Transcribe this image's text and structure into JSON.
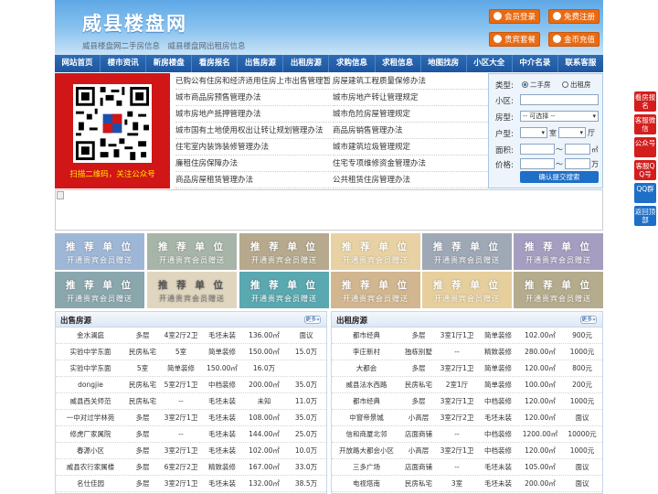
{
  "header": {
    "title": "威县楼盘网",
    "subtitle": "威县楼盘网二手房信息　威县楼盘网出租房信息",
    "buttons": [
      "会员登录",
      "免费注册",
      "贵宾套餐",
      "金币充值"
    ]
  },
  "nav": [
    "网站首页",
    "楼市资讯",
    "新房楼盘",
    "看房报名",
    "出售房源",
    "出租房源",
    "求购信息",
    "求租信息",
    "地图找房",
    "小区大全",
    "中介名录",
    "联系客服"
  ],
  "qr": {
    "caption": "扫描二维码，关注公众号"
  },
  "news": {
    "left": [
      "已购公有住房和经济适用住房上市出售管理暂",
      "城市商品房预售管理办法",
      "城市房地产抵押管理办法",
      "城市国有土地使用权出让转让规划管理办法",
      "住宅室内装饰装修管理办法",
      "廉租住房保障办法",
      "商品房屋租赁管理办法"
    ],
    "right": [
      "房屋建筑工程质量保修办法",
      "城市房地产转让管理规定",
      "城市危险房屋管理规定",
      "商品房销售管理办法",
      "城市建筑垃圾管理规定",
      "住宅专项维修资金管理办法",
      "公共租赁住房管理办法"
    ]
  },
  "search": {
    "type_label": "类型:",
    "type_options": [
      "二手房",
      "出租房"
    ],
    "community_label": "小区:",
    "house_type_label": "房型:",
    "house_type_value": "-- 可选择 --",
    "layout_label": "户型:",
    "room_unit": "室",
    "hall_unit": "厅",
    "area_label": "面积:",
    "area_sep": "～",
    "area_unit": "㎡",
    "price_label": "价格:",
    "price_sep": "～",
    "price_unit": "万",
    "submit": "确认提交搜索"
  },
  "ads": {
    "title": "推 荐 单 位",
    "subtitle": "开通贵宾会员赠送"
  },
  "sale": {
    "title": "出售房源",
    "more": "更多»",
    "rows": [
      [
        "金水澜庭",
        "多层",
        "4室2厅2卫",
        "毛坯未装",
        "136.00㎡",
        "面议"
      ],
      [
        "实验中学东面",
        "民房私宅",
        "5室",
        "简单装修",
        "150.00㎡",
        "15.0万"
      ],
      [
        "实验中学东面",
        "5室",
        "简单装修",
        "150.00㎡",
        "16.0万"
      ],
      [
        "dongjie",
        "民房私宅",
        "5室2厅1卫",
        "中档装修",
        "200.00㎡",
        "35.0万"
      ],
      [
        "威县西关师范",
        "民房私宅",
        "--",
        "毛坯未装",
        "未知",
        "11.0万"
      ],
      [
        "一中对过学林苑",
        "多层",
        "3室2厅1卫",
        "毛坯未装",
        "108.00㎡",
        "35.0万"
      ],
      [
        "修虎厂家属院",
        "多层",
        "--",
        "毛坯未装",
        "144.00㎡",
        "25.0万"
      ],
      [
        "春源小区",
        "多层",
        "3室2厅1卫",
        "毛坯未装",
        "102.00㎡",
        "10.0万"
      ],
      [
        "威县农行家属楼",
        "多层",
        "6室2厅2卫",
        "精致装修",
        "167.00㎡",
        "33.0万"
      ],
      [
        "名仕佳园",
        "多层",
        "3室2厅1卫",
        "毛坯未装",
        "132.00㎡",
        "38.5万"
      ]
    ]
  },
  "rent": {
    "title": "出租房源",
    "more": "更多»",
    "rows": [
      [
        "都市经典",
        "多层",
        "3室1厅1卫",
        "简单装修",
        "102.00㎡",
        "900元"
      ],
      [
        "李庄新村",
        "独栋别墅",
        "--",
        "精致装修",
        "280.00㎡",
        "1000元"
      ],
      [
        "大都会",
        "多层",
        "3室2厅1卫",
        "简单装修",
        "120.00㎡",
        "800元"
      ],
      [
        "威县法水西路",
        "民房私宅",
        "2室1厅",
        "简单装修",
        "100.00㎡",
        "200元"
      ],
      [
        "都市经典",
        "多层",
        "3室2厅1卫",
        "中档装修",
        "120.00㎡",
        "1000元"
      ],
      [
        "中窗帝景城",
        "小高层",
        "3室2厅2卫",
        "毛坯未装",
        "120.00㎡",
        "面议"
      ],
      [
        "信和商厦北邻",
        "店面商铺",
        "--",
        "中档装修",
        "1200.00㎡",
        "10000元"
      ],
      [
        "开放路大都会小区",
        "小高层",
        "3室2厅1卫",
        "中档装修",
        "120.00㎡",
        "1000元"
      ],
      [
        "三多广场",
        "店面商铺",
        "--",
        "毛坯未装",
        "105.00㎡",
        "面议"
      ],
      [
        "电视塔南",
        "民房私宅",
        "3室",
        "毛坯未装",
        "200.00㎡",
        "面议"
      ]
    ]
  },
  "side": [
    "看房报名",
    "客服微信",
    "公众号",
    "客服QQ号",
    "QQ群",
    "返回顶部"
  ]
}
